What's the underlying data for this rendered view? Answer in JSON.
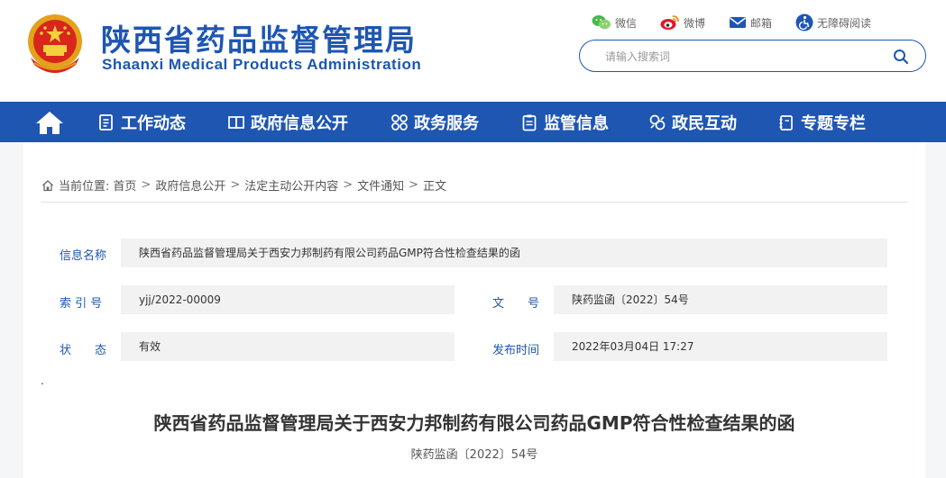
{
  "header": {
    "title": "陕西省药品监督管理局",
    "subtitle": "Shaanxi Medical Products Administration",
    "toplinks": {
      "wechat": "微信",
      "weibo": "微博",
      "mail": "邮箱",
      "accessibility": "无障碍阅读"
    },
    "search": {
      "placeholder": "请输入搜索词"
    }
  },
  "nav": {
    "items": [
      {
        "label": "工作动态",
        "icon": "document-list-icon"
      },
      {
        "label": "政府信息公开",
        "icon": "book-icon"
      },
      {
        "label": "政务服务",
        "icon": "grid-icon"
      },
      {
        "label": "监管信息",
        "icon": "clipboard-icon"
      },
      {
        "label": "政民互动",
        "icon": "interaction-icon"
      },
      {
        "label": "专题专栏",
        "icon": "notebook-icon"
      }
    ]
  },
  "breadcrumb": {
    "prefix": "当前位置:",
    "items": [
      "首页",
      "政府信息公开",
      "法定主动公开内容",
      "文件通知",
      "正文"
    ],
    "separator": ">"
  },
  "info": {
    "name_label": "信息名称",
    "name_value": "陕西省药品监督管理局关于西安力邦制药有限公司药品GMP符合性检查结果的函",
    "index_label": "索 引 号",
    "index_value": "yjj/2022-00009",
    "docno_label": "文　　号",
    "docno_value": "陕药监函〔2022〕54号",
    "status_label": "状　　态",
    "status_value": "有效",
    "date_label": "发布时间",
    "date_value": "2022年03月04日 17:27"
  },
  "article": {
    "dot": ".",
    "title": "陕西省药品监督管理局关于西安力邦制药有限公司药品GMP符合性检查结果的函",
    "number": "陕药监函〔2022〕54号"
  },
  "colors": {
    "brand": "#1e56b2",
    "background": "#f5f6f8",
    "field": "#f2f2f2"
  }
}
